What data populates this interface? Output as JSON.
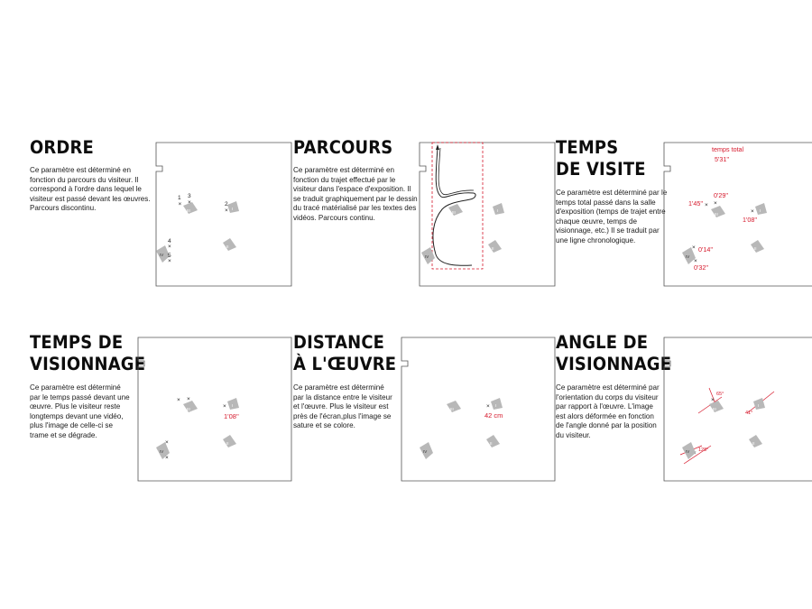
{
  "panels": [
    {
      "id": "ordre",
      "title": "ORDRE",
      "description": "Ce paramètre est déterminé en fonction du parcours du visiteur. Il correspond à l'ordre dans lequel le visiteur est passé devant les œuvres. Parcours discontinu."
    },
    {
      "id": "parcours",
      "title": "PARCOURS",
      "description": "Ce paramètre est déterminé en fonction du trajet effectué par le visiteur dans l'espace d'exposition. Il se traduit graphiquement par le dessin du tracé matérialisé par les textes des vidéos. Parcours continu."
    },
    {
      "id": "temps-de-visite",
      "title": "TEMPS\nDE VISITE",
      "description": "Ce paramètre est déterminé par le temps total passé dans la salle d'exposition (temps de trajet entre chaque œuvre, temps de visionnage, etc.) Il se traduit par une ligne chronologique."
    },
    {
      "id": "temps-de-visionnage",
      "title": "TEMPS DE\nVISIONNAGE",
      "description": "Ce paramètre est déterminé par le temps passé devant une œuvre. Plus le visiteur reste longtemps devant une vidéo, plus l'image de celle-ci se trame et se dégrade."
    },
    {
      "id": "distance",
      "title": "DISTANCE\nÀ L'ŒUVRE",
      "description": "Ce paramètre est déterminé par la distance entre le visiteur et l'œuvre. Plus le visiteur est près de l'écran,plus l'image se sature et se colore."
    },
    {
      "id": "angle",
      "title": "ANGLE DE\nVISIONNAGE",
      "description": "Ce paramètre est déterminé par l'orientation du corps du visiteur par rapport à l'œuvre. L'image est alors déformée en fonction de l'angle donné par la position du visiteur."
    }
  ],
  "artworks": [
    "I",
    "II",
    "III",
    "IV"
  ],
  "annotations": {
    "ordre_numbers": [
      "1",
      "3",
      "2",
      "4",
      "5"
    ],
    "visite_total_label": "temps total",
    "visite_total_value": "5'31''",
    "visite_times": [
      "1'45''",
      "0'29''",
      "1'08''",
      "0'14''",
      "0'32''"
    ],
    "visionnage_time": "1'08''",
    "distance_value": "42 cm",
    "angles": [
      "65°",
      "41°",
      "128°"
    ]
  },
  "colors": {
    "accent": "#d6182b",
    "artwork_fill": "#b8b8b8",
    "plan_stroke": "#555555",
    "text": "#111111"
  }
}
